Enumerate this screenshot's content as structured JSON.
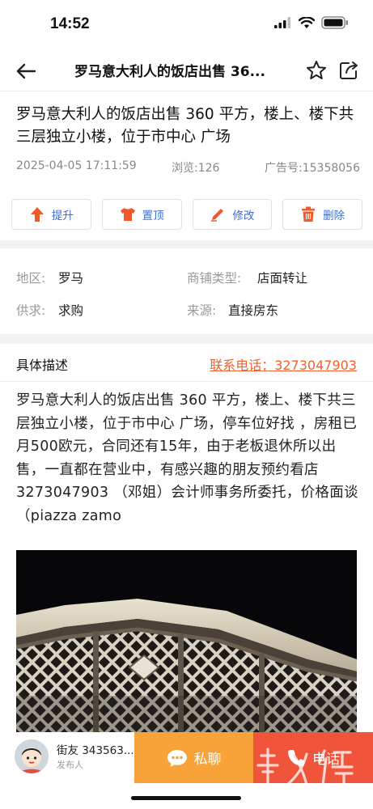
{
  "status": {
    "time": "14:52"
  },
  "navbar": {
    "title": "罗马意大利人的饭店出售 36..."
  },
  "post": {
    "headline": "罗马意大利人的饭店出售 360 平方，楼上、楼下共三层独立小楼，位于市中心 广场",
    "date": "2025-04-05 17:11:59",
    "views": "浏览:126",
    "ad_no": "广告号:15358056"
  },
  "actions": [
    {
      "label": "提升",
      "icon": "arrow-up-icon"
    },
    {
      "label": "置顶",
      "icon": "shirt-icon"
    },
    {
      "label": "修改",
      "icon": "pencil-icon"
    },
    {
      "label": "删除",
      "icon": "trash-icon"
    }
  ],
  "info": {
    "region_label": "地区:",
    "region_value": "罗马",
    "shop_type_label": "商铺类型:",
    "shop_type_value": "店面转让",
    "supply_label": "供求:",
    "supply_value": "求购",
    "source_label": "来源:",
    "source_value": "直接房东"
  },
  "description": {
    "label": "具体描述",
    "phone": "联系电话：3273047903",
    "body": "罗马意大利人的饭店出售  360  平方，楼上、楼下共三层独立小楼，位于市中心  广场，停车位好找  ，房租已月500欧元，合同还有15年，由于老板退休所以出售，一直都在营业中，有感兴趣的朋友预约看店  3273047903  （邓姐）会计师事务所委托，价格面谈（piazza zamo"
  },
  "bottom": {
    "user_name": "街友 343563...",
    "user_role": "发布人",
    "chat_label": "私聊",
    "call_label": "电话"
  },
  "watermark": {
    "text": "HUARENJIE"
  },
  "colors": {
    "accent_blue": "#3a6fd6",
    "accent_orange": "#f0612e",
    "chat_bg": "#f7a33a",
    "call_bg": "#f0543a"
  }
}
